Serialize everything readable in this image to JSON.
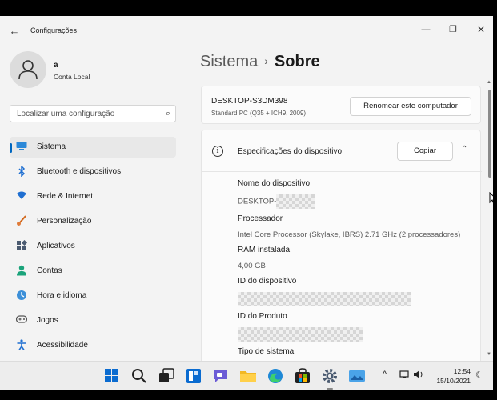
{
  "window": {
    "app_title": "Configurações",
    "back": "←",
    "minimize": "—",
    "maximize": "❐",
    "close": "✕"
  },
  "user": {
    "name": "a",
    "account_type": "Conta Local"
  },
  "search": {
    "placeholder": "Localizar uma configuração",
    "icon": "search-icon"
  },
  "sidebar": {
    "items": [
      {
        "label": "Sistema",
        "icon": "monitor-icon",
        "active": true
      },
      {
        "label": "Bluetooth e dispositivos",
        "icon": "bluetooth-icon"
      },
      {
        "label": "Rede & Internet",
        "icon": "wifi-icon"
      },
      {
        "label": "Personalização",
        "icon": "brush-icon"
      },
      {
        "label": "Aplicativos",
        "icon": "apps-icon"
      },
      {
        "label": "Contas",
        "icon": "person-icon"
      },
      {
        "label": "Hora e idioma",
        "icon": "globe-clock-icon"
      },
      {
        "label": "Jogos",
        "icon": "gamepad-icon"
      },
      {
        "label": "Acessibilidade",
        "icon": "accessibility-icon"
      }
    ]
  },
  "breadcrumb": {
    "parent": "Sistema",
    "separator": "›",
    "current": "Sobre"
  },
  "device": {
    "name": "DESKTOP-S3DM398",
    "model": "Standard PC (Q35 + ICH9, 2009)",
    "rename_button": "Renomear este computador"
  },
  "specs": {
    "title": "Especificações do dispositivo",
    "copy_button": "Copiar",
    "fields": {
      "device_name_label": "Nome do dispositivo",
      "device_name_value": "DESKTOP-",
      "processor_label": "Processador",
      "processor_value": "Intel Core Processor (Skylake, IBRS)   2.71 GHz  (2 processadores)",
      "ram_label": "RAM instalada",
      "ram_value": "4,00 GB",
      "device_id_label": "ID do dispositivo",
      "product_id_label": "ID do Produto",
      "system_type_label": "Tipo de sistema"
    }
  },
  "taskbar": {
    "time": "12:54",
    "date": "15/10/2021",
    "tray": [
      "^",
      "⌁",
      "🔈",
      "☾"
    ]
  },
  "colors": {
    "accent": "#0067c0",
    "window_bg": "#f3f3f3",
    "card_bg": "#fbfbfb"
  }
}
